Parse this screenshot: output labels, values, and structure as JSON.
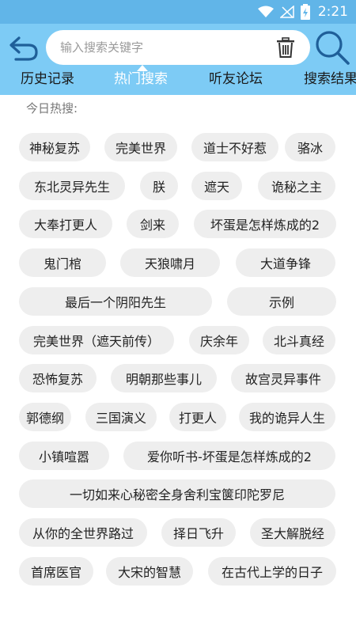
{
  "status": {
    "time": "2:21"
  },
  "search": {
    "placeholder": "输入搜索关键字"
  },
  "tabs": [
    {
      "label": "历史记录"
    },
    {
      "label": "热门搜索"
    },
    {
      "label": "听友论坛"
    },
    {
      "label": "搜索结果"
    }
  ],
  "hot": {
    "title": "今日热搜:",
    "tags": [
      "神秘复苏",
      "完美世界",
      "道士不好惹",
      "骆冰",
      "东北灵异先生",
      "朕",
      "遮天",
      "诡秘之主",
      "大奉打更人",
      "剑来",
      "坏蛋是怎样炼成的2",
      "鬼门棺",
      "天狼啸月",
      "大道争锋",
      "最后一个阴阳先生",
      "示例",
      "完美世界（遮天前传）",
      "庆余年",
      "北斗真经",
      "恐怖复苏",
      "明朝那些事儿",
      "故宫灵异事件",
      "郭德纲",
      "三国演义",
      "打更人",
      "我的诡异人生",
      "小镇喧嚣",
      "爱你听书-坏蛋是怎样炼成的2",
      "一切如来心秘密全身舍利宝箧印陀罗尼",
      "从你的全世界路过",
      "择日飞升",
      "圣大解脱经",
      "首席医官",
      "大宋的智慧",
      "在古代上学的日子"
    ]
  },
  "colors": {
    "status_bar": "#61b5e8",
    "app_bar": "#7dcbf5",
    "icon": "#1f5f99",
    "tag_bg": "#eeeeee"
  }
}
